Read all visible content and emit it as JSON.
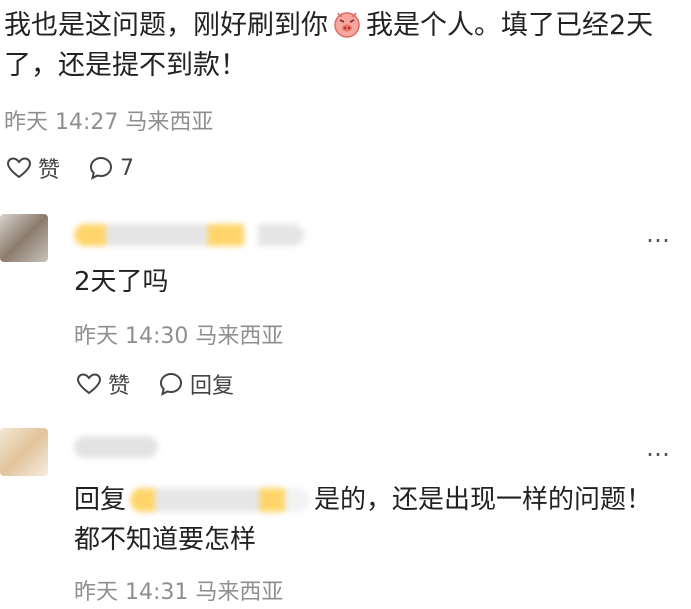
{
  "post": {
    "text_part1": "我也是这问题，刚好刷到你",
    "text_part2": "我是个人。填了已经2天了，还是提不到款！",
    "emoji_icon": "crying-pig-emoji-icon",
    "meta": "昨天 14:27 马来西亚",
    "like_label": "赞",
    "comment_count": "7"
  },
  "comments": [
    {
      "text": "2天了吗",
      "meta": "昨天 14:30 马来西亚",
      "like_label": "赞",
      "reply_label": "回复",
      "more": "…"
    },
    {
      "reply_prefix": "回复",
      "text": "是的，还是出现一样的问题！都不知道要怎样",
      "meta": "昨天 14:31 马来西亚",
      "more": "…"
    }
  ],
  "colors": {
    "meta": "#8f8f8f",
    "text": "#222222",
    "blur_accent": "#ffd56b"
  }
}
